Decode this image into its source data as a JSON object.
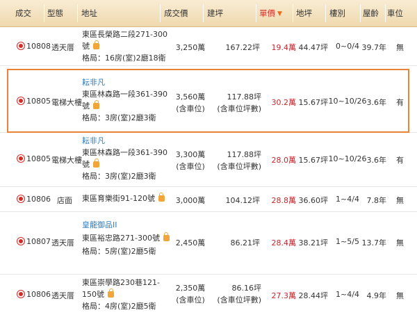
{
  "header": {
    "date": "成交",
    "type": "型態",
    "address": "地址",
    "price": "成交價",
    "area": "建坪",
    "unit_price": "單價",
    "land": "地坪",
    "floor": "樓別",
    "age": "屋齡",
    "parking": "車位"
  },
  "rows": [
    {
      "date": "10808",
      "type": "透天厝",
      "building": "",
      "addr1": "東區長榮路二段271-300",
      "addr2": "號",
      "layout": "格局：16房(室)2廳18衛",
      "price": "3,250萬",
      "price_note": "",
      "area": "167.22坪",
      "area_note": "",
      "unit_price": "19.4萬",
      "land": "44.47坪",
      "floor": "0~0/4",
      "age": "39.7年",
      "parking": "無"
    },
    {
      "date": "10805",
      "type": "電梯大樓",
      "building": "耘非凡",
      "addr1": "東區林森路一段361-390",
      "addr2": "號",
      "layout": "格局：3房(室)2廳3衛",
      "price": "3,560萬",
      "price_note": "(含車位)",
      "area": "117.88坪",
      "area_note": "(含車位坪數)",
      "unit_price": "30.2萬",
      "land": "15.67坪",
      "floor": "10~10/26",
      "age": "3.6年",
      "parking": "有"
    },
    {
      "date": "10805",
      "type": "電梯大樓",
      "building": "耘非凡",
      "addr1": "東區林森路一段361-390",
      "addr2": "號",
      "layout": "格局：3房(室)2廳3衛",
      "price": "3,300萬",
      "price_note": "(含車位)",
      "area": "117.88坪",
      "area_note": "(含車位坪數)",
      "unit_price": "28.0萬",
      "land": "15.67坪",
      "floor": "10~10/26",
      "age": "3.6年",
      "parking": "有"
    },
    {
      "date": "10806",
      "type": "店面",
      "building": "",
      "addr1": "東區育樂街91-120號",
      "addr2": "",
      "layout": "",
      "price": "3,000萬",
      "price_note": "",
      "area": "104.12坪",
      "area_note": "",
      "unit_price": "28.8萬",
      "land": "36.60坪",
      "floor": "1~4/4",
      "age": "7.8年",
      "parking": "無"
    },
    {
      "date": "10807",
      "type": "透天厝",
      "building": "皇龍御品II",
      "addr1": "東區裕忠路271-300號",
      "addr2": "",
      "layout": "格局：5房(室)2廳5衛",
      "price": "2,450萬",
      "price_note": "",
      "area": "86.21坪",
      "area_note": "",
      "unit_price": "28.4萬",
      "land": "38.21坪",
      "floor": "1~5/5",
      "age": "13.7年",
      "parking": "無"
    },
    {
      "date": "10806",
      "type": "透天厝",
      "building": "",
      "addr1": "東區崇學路230巷121-",
      "addr2": "150號",
      "layout": "格局：4房(室)2廳5衛",
      "price": "2,350萬",
      "price_note": "(含車位)",
      "area": "86.16坪",
      "area_note": "(含車位坪數)",
      "unit_price": "27.3萬",
      "land": "28.44坪",
      "floor": "1~4/4",
      "age": "4.9年",
      "parking": "無"
    }
  ]
}
